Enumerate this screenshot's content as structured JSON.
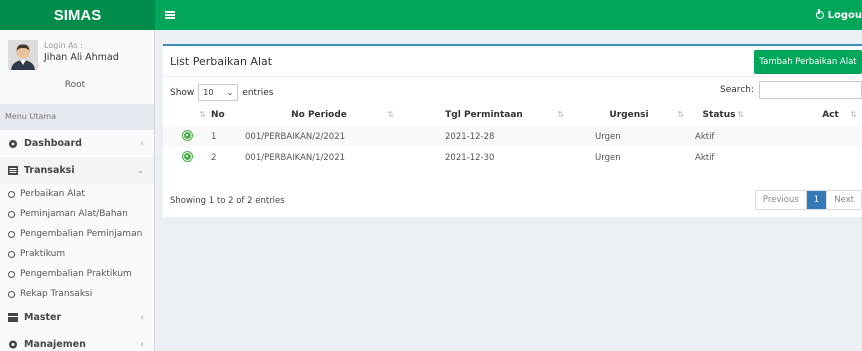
{
  "header": {
    "brand": "SIMAS",
    "logout_label": "Logou"
  },
  "user": {
    "login_as": "Login As :",
    "name": "Jihan Ali Ahmad",
    "role": "Root"
  },
  "sidebar": {
    "menu_header": "Menu Utama",
    "items": [
      {
        "label": "Dashboard",
        "icon": "dashboard-icon",
        "chevron": "‹"
      },
      {
        "label": "Transaksi",
        "icon": "list-icon",
        "chevron": "⌄"
      },
      {
        "label": "Master",
        "icon": "master-icon",
        "chevron": "‹"
      },
      {
        "label": "Manajemen",
        "icon": "gear-icon",
        "chevron": "‹"
      }
    ],
    "sub_items": [
      "Perbaikan Alat",
      "Peminjaman Alat/Bahan",
      "Pengembalian Peminjaman",
      "Praktikum",
      "Pengembalian Praktikum",
      "Rekap Transaksi"
    ]
  },
  "main": {
    "title": "List Perbaikan Alat",
    "add_button": "Tambah Perbaikan Alat",
    "show_label": "Show",
    "entries_value": "10",
    "entries_label": "entries",
    "search_label": "Search:",
    "columns": [
      "No",
      "No Periode",
      "Tgl Permintaan",
      "Urgensi",
      "Status",
      "Act"
    ],
    "rows": [
      {
        "no": "1",
        "periode": "001/PERBAIKAN/2/2021",
        "tgl": "2021-12-28",
        "urgensi": "Urgen",
        "status": "Aktif"
      },
      {
        "no": "2",
        "periode": "001/PERBAIKAN/1/2021",
        "tgl": "2021-12-30",
        "urgensi": "Urgen",
        "status": "Aktif"
      }
    ],
    "info": "Showing 1 to 2 of 2 entries",
    "pager": {
      "prev": "Previous",
      "current": "1",
      "next": "Next"
    }
  },
  "colors": {
    "header_green": "#00a65a",
    "brand_green": "#008d4c",
    "accent_blue": "#3c8dbc",
    "pager_blue": "#337ab7"
  }
}
